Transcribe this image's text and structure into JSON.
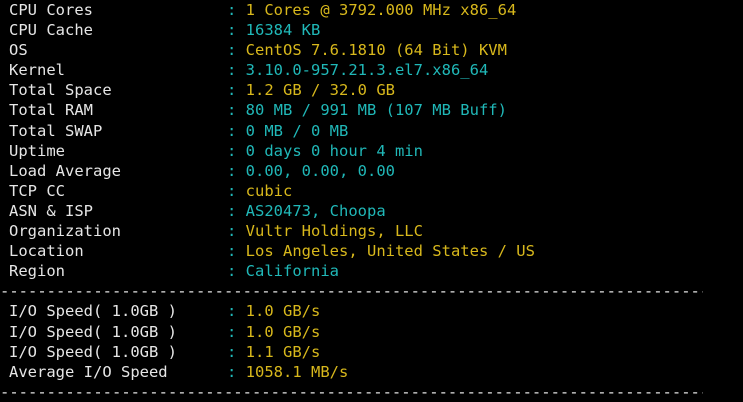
{
  "colors": {
    "background": "#000000",
    "label": "#e6e6e6",
    "yellow": "#d8b81c",
    "cyan": "#20b8b8"
  },
  "separator": ": ",
  "divider": "-----------------------------------------------------------------------------",
  "system_rows": [
    {
      "label": "CPU Cores",
      "value": "1 Cores @ 3792.000 MHz x86_64",
      "color": "yellow"
    },
    {
      "label": "CPU Cache",
      "value": "16384 KB",
      "color": "cyan"
    },
    {
      "label": "OS",
      "value": "CentOS 7.6.1810 (64 Bit) KVM",
      "color": "yellow"
    },
    {
      "label": "Kernel",
      "value": "3.10.0-957.21.3.el7.x86_64",
      "color": "cyan"
    },
    {
      "label": "Total Space",
      "value": "1.2 GB / 32.0 GB",
      "color": "yellow"
    },
    {
      "label": "Total RAM",
      "value": "80 MB / 991 MB (107 MB Buff)",
      "color": "cyan"
    },
    {
      "label": "Total SWAP",
      "value": "0 MB / 0 MB",
      "color": "cyan"
    },
    {
      "label": "Uptime",
      "value": "0 days 0 hour 4 min",
      "color": "cyan"
    },
    {
      "label": "Load Average",
      "value": "0.00, 0.00, 0.00",
      "color": "cyan"
    },
    {
      "label": "TCP CC",
      "value": "cubic",
      "color": "yellow"
    },
    {
      "label": "ASN & ISP",
      "value": "AS20473, Choopa",
      "color": "cyan"
    },
    {
      "label": "Organization",
      "value": "Vultr Holdings, LLC",
      "color": "yellow"
    },
    {
      "label": "Location",
      "value": "Los Angeles, United States / US",
      "color": "yellow"
    },
    {
      "label": "Region",
      "value": "California",
      "color": "cyan"
    }
  ],
  "io_rows": [
    {
      "label": "I/O Speed( 1.0GB )",
      "value": "1.0 GB/s",
      "color": "yellow"
    },
    {
      "label": "I/O Speed( 1.0GB )",
      "value": "1.0 GB/s",
      "color": "yellow"
    },
    {
      "label": "I/O Speed( 1.0GB )",
      "value": "1.1 GB/s",
      "color": "yellow"
    },
    {
      "label": "Average I/O Speed",
      "value": "1058.1 MB/s",
      "color": "yellow"
    }
  ]
}
